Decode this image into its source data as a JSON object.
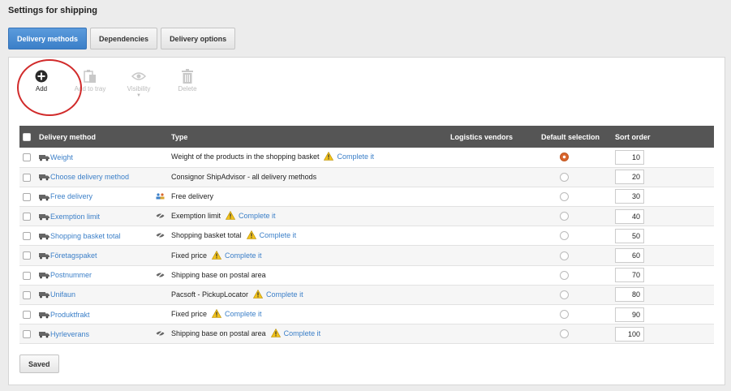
{
  "page": {
    "title": "Settings for shipping"
  },
  "tabs": [
    "Delivery methods",
    "Dependencies",
    "Delivery options"
  ],
  "toolbar": {
    "add": "Add",
    "add_to_tray": "Add to tray",
    "visibility": "Visibility",
    "delete": "Delete"
  },
  "table": {
    "headers": {
      "method": "Delivery method",
      "type": "Type",
      "vendors": "Logistics vendors",
      "default": "Default selection",
      "sort": "Sort order"
    },
    "rows": [
      {
        "name": "Weight",
        "type": "Weight of the products in the shopping basket",
        "warning": "Complete it",
        "icon": "",
        "default": true,
        "sort": "10"
      },
      {
        "name": "Choose delivery method",
        "type": "Consignor ShipAdvisor - all delivery methods",
        "warning": "",
        "icon": "",
        "default": false,
        "sort": "20"
      },
      {
        "name": "Free delivery",
        "type": "Free delivery",
        "warning": "",
        "icon": "group-icon",
        "default": false,
        "sort": "30"
      },
      {
        "name": "Exemption limit",
        "type": "Exemption limit",
        "warning": "Complete it",
        "icon": "hidden-icon",
        "default": false,
        "sort": "40"
      },
      {
        "name": "Shopping basket total",
        "type": "Shopping basket total",
        "warning": "Complete it",
        "icon": "hidden-icon",
        "default": false,
        "sort": "50"
      },
      {
        "name": "Företagspaket",
        "type": "Fixed price",
        "warning": "Complete it",
        "icon": "",
        "default": false,
        "sort": "60"
      },
      {
        "name": "Postnummer",
        "type": "Shipping base on postal area",
        "warning": "",
        "icon": "hidden-icon",
        "default": false,
        "sort": "70"
      },
      {
        "name": "Unifaun",
        "type": "Pacsoft - PickupLocator",
        "warning": "Complete it",
        "icon": "",
        "default": false,
        "sort": "80"
      },
      {
        "name": "Produktfrakt",
        "type": "Fixed price",
        "warning": "Complete it",
        "icon": "",
        "default": false,
        "sort": "90"
      },
      {
        "name": "Hyrleverans",
        "type": "Shipping base on postal area",
        "warning": "Complete it",
        "icon": "hidden-icon",
        "default": false,
        "sort": "100"
      }
    ]
  },
  "footer": {
    "saved_label": "Saved"
  },
  "colors": {
    "accent": "#3b7fc8",
    "header_bg": "#555555",
    "highlight": "#d12b2b",
    "warning": "#f2c21b"
  }
}
